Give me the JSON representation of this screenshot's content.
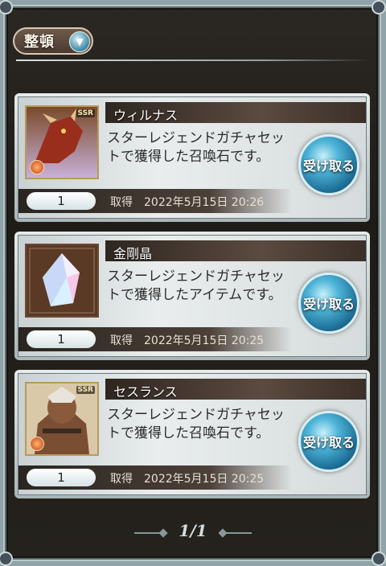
{
  "toolbar": {
    "sort_label": "整頓",
    "sort_icon": "chevron-down-icon"
  },
  "items": [
    {
      "title": "ウィルナス",
      "description": "スターレジェンドガチャセットで獲得した召喚石です。",
      "quantity": "1",
      "acquired_label": "取得",
      "acquired_date": "2022年5月15日 20:26",
      "claim_label": "受け取る",
      "badge": "SSR"
    },
    {
      "title": "金剛晶",
      "description": "スターレジェンドガチャセットで獲得したアイテムです。",
      "quantity": "1",
      "acquired_label": "取得",
      "acquired_date": "2022年5月15日 20:25",
      "claim_label": "受け取る"
    },
    {
      "title": "セスランス",
      "description": "スターレジェンドガチャセットで獲得した召喚石です。",
      "quantity": "1",
      "acquired_label": "取得",
      "acquired_date": "2022年5月15日 20:25",
      "claim_label": "受け取る",
      "badge": "SSR"
    }
  ],
  "pagination": {
    "text": "1/1"
  }
}
